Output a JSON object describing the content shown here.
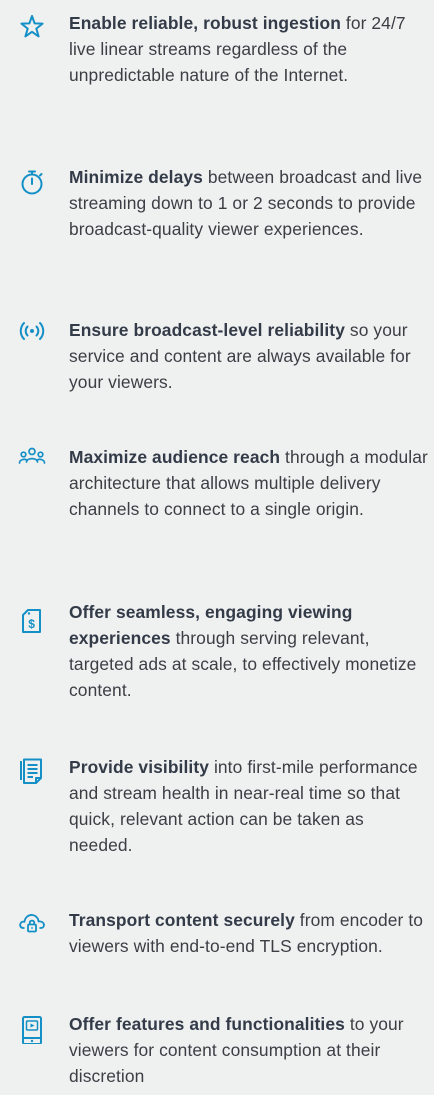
{
  "colors": {
    "background": "#eff0f0",
    "icon": "#1590c6",
    "heading_text": "#333b48",
    "body_text": "#3c3e44"
  },
  "items": [
    {
      "icon": "star-icon",
      "lead": "Enable reliable, robust ingestion",
      "rest": " for 24/7 live linear streams regardless of the unpredictable nature of the Internet."
    },
    {
      "icon": "stopwatch-icon",
      "lead": "Minimize delays",
      "rest": " between broadcast and live streaming down to 1 or 2 seconds to provide broadcast-quality viewer experiences."
    },
    {
      "icon": "broadcast-signal-icon",
      "lead": "Ensure broadcast-level reliability",
      "rest": " so your service and content are always available for your viewers."
    },
    {
      "icon": "audience-icon",
      "lead": "Maximize audience reach",
      "rest": " through a modular architecture that allows multiple delivery channels to connect to a single origin."
    },
    {
      "icon": "price-tag-icon",
      "lead": "Offer seamless, engaging viewing experiences",
      "rest": " through serving relevant, targeted ads at scale, to effectively monetize content."
    },
    {
      "icon": "document-icon",
      "lead": "Provide visibility",
      "rest": " into first-mile performance and stream health in near-real time so that quick, relevant action can be taken as needed."
    },
    {
      "icon": "cloud-lock-icon",
      "lead": "Transport content securely",
      "rest": " from encoder to viewers with end-to-end TLS encryption."
    },
    {
      "icon": "mobile-video-icon",
      "lead": "Offer features and functionalities",
      "rest": " to your viewers for content consumption at their discretion"
    }
  ]
}
